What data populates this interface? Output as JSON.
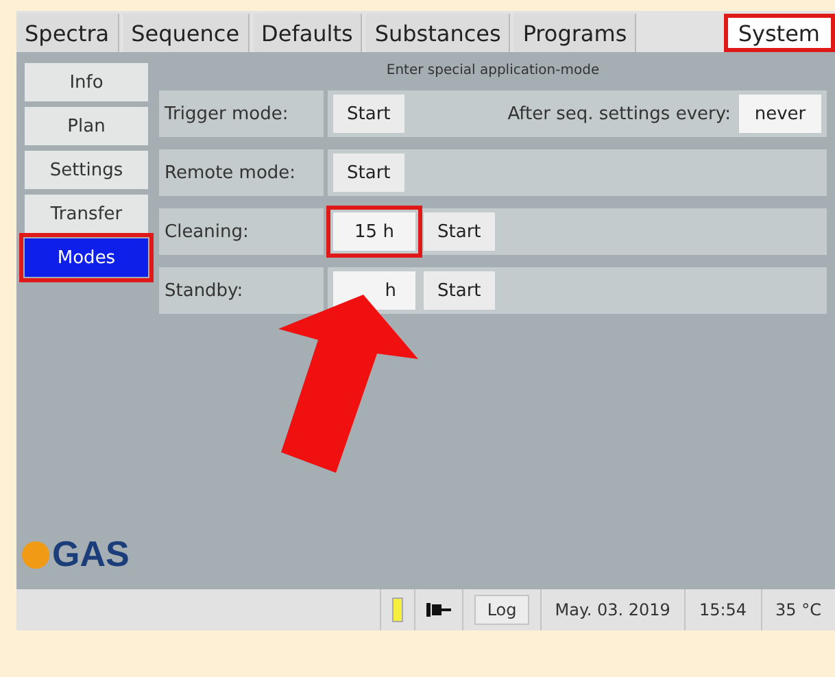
{
  "tabs": [
    {
      "label": "Spectra",
      "selected": false,
      "highlighted": false
    },
    {
      "label": "Sequence",
      "selected": false,
      "highlighted": false
    },
    {
      "label": "Defaults",
      "selected": false,
      "highlighted": false
    },
    {
      "label": "Substances",
      "selected": false,
      "highlighted": false
    },
    {
      "label": "Programs",
      "selected": false,
      "highlighted": false
    },
    {
      "label": "System",
      "selected": true,
      "highlighted": true
    }
  ],
  "sidebar": {
    "items": [
      {
        "label": "Info",
        "selected": false,
        "highlighted": false
      },
      {
        "label": "Plan",
        "selected": false,
        "highlighted": false
      },
      {
        "label": "Settings",
        "selected": false,
        "highlighted": false
      },
      {
        "label": "Transfer",
        "selected": false,
        "highlighted": false
      },
      {
        "label": "Modes",
        "selected": true,
        "highlighted": true
      }
    ]
  },
  "panel": {
    "title": "Enter special application-mode",
    "rows": [
      {
        "label": "Trigger mode:",
        "items": [
          {
            "kind": "button",
            "text": "Start"
          },
          {
            "kind": "label",
            "text": "After seq. settings every:"
          },
          {
            "kind": "field",
            "text": "never",
            "highlighted": false
          }
        ]
      },
      {
        "label": "Remote mode:",
        "items": [
          {
            "kind": "button",
            "text": "Start"
          }
        ]
      },
      {
        "label": "Cleaning:",
        "items": [
          {
            "kind": "field",
            "text": "15 h",
            "highlighted": true
          },
          {
            "kind": "button",
            "text": "Start"
          }
        ]
      },
      {
        "label": "Standby:",
        "items": [
          {
            "kind": "field",
            "text": "h",
            "highlighted": false
          },
          {
            "kind": "button",
            "text": "Start"
          }
        ]
      }
    ]
  },
  "logo": {
    "text": "GAS"
  },
  "status_bar": {
    "log_button": "Log",
    "date": "May. 03. 2019",
    "time": "15:54",
    "temperature": "35 °C"
  }
}
